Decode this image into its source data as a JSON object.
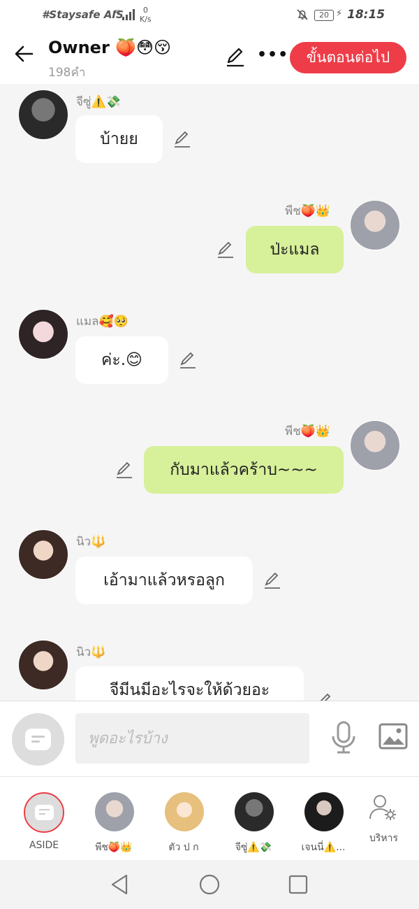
{
  "status_bar": {
    "carrier": "#Staysafe AIS",
    "network": "4G",
    "speed_value": "0",
    "speed_unit": "K/s",
    "battery": "20",
    "time": "18:15",
    "icons": [
      "signal-icon",
      "mute-bell-icon",
      "battery-icon",
      "charging-bolt-icon"
    ]
  },
  "header": {
    "title": "Owner 🍑😳😚",
    "word_count": "198คำ",
    "next_button": "ขั้นตอนต่อไป",
    "more_label": "•••",
    "icons": [
      "back-arrow-icon",
      "edit-pencil-icon",
      "more-dots-icon"
    ]
  },
  "messages": [
    {
      "speaker": "จีซู่⚠️💸",
      "text": "บ้ายย",
      "side": "left",
      "avatar_color": "#3a3a3a"
    },
    {
      "speaker": "พีช🍑👑",
      "text": "ป่ะแมล",
      "side": "right",
      "avatar_color": "#b9b9c2"
    },
    {
      "speaker": "แมล🥰🥺",
      "text": "ค่ะ.😊",
      "side": "left",
      "avatar_color": "#d49aa2"
    },
    {
      "speaker": "พีช🍑👑",
      "text": "กับมาแล้วคร้าบ~~~",
      "side": "right",
      "avatar_color": "#b9b9c2"
    },
    {
      "speaker": "นิว🔱",
      "text": "เอ้ามาแล้วหรอลูก",
      "side": "left",
      "avatar_color": "#8c6a5c"
    },
    {
      "speaker": "นิว🔱",
      "text": "จีมีนมีอะไรจะให้ด้วยอะ",
      "side": "left",
      "avatar_color": "#8c6a5c"
    }
  ],
  "input": {
    "placeholder": "พูดอะไรบ้าง",
    "icons": [
      "aside-icon",
      "microphone-icon",
      "image-gallery-icon"
    ]
  },
  "character_bar": [
    {
      "label": "ASIDE",
      "avatar_color": "#dddddd"
    },
    {
      "label": "พีช🍑👑",
      "avatar_color": "#a9a9b3"
    },
    {
      "label": "ตัว ป ก",
      "avatar_color": "#e8c38a"
    },
    {
      "label": "จีซู่⚠️💸",
      "avatar_color": "#3b3b3b"
    },
    {
      "label": "เจนนี่⚠️...",
      "avatar_color": "#2a2a2a"
    },
    {
      "label": "บริหาร",
      "avatar_color": "#8a8a8a"
    }
  ],
  "colors": {
    "accent": "#ee3d48",
    "outgoing_bubble": "#d7f09a",
    "incoming_bubble": "#ffffff",
    "background": "#f5f5f5"
  },
  "navigation": {
    "icons": [
      "nav-back-icon",
      "nav-home-icon",
      "nav-recents-icon"
    ]
  }
}
